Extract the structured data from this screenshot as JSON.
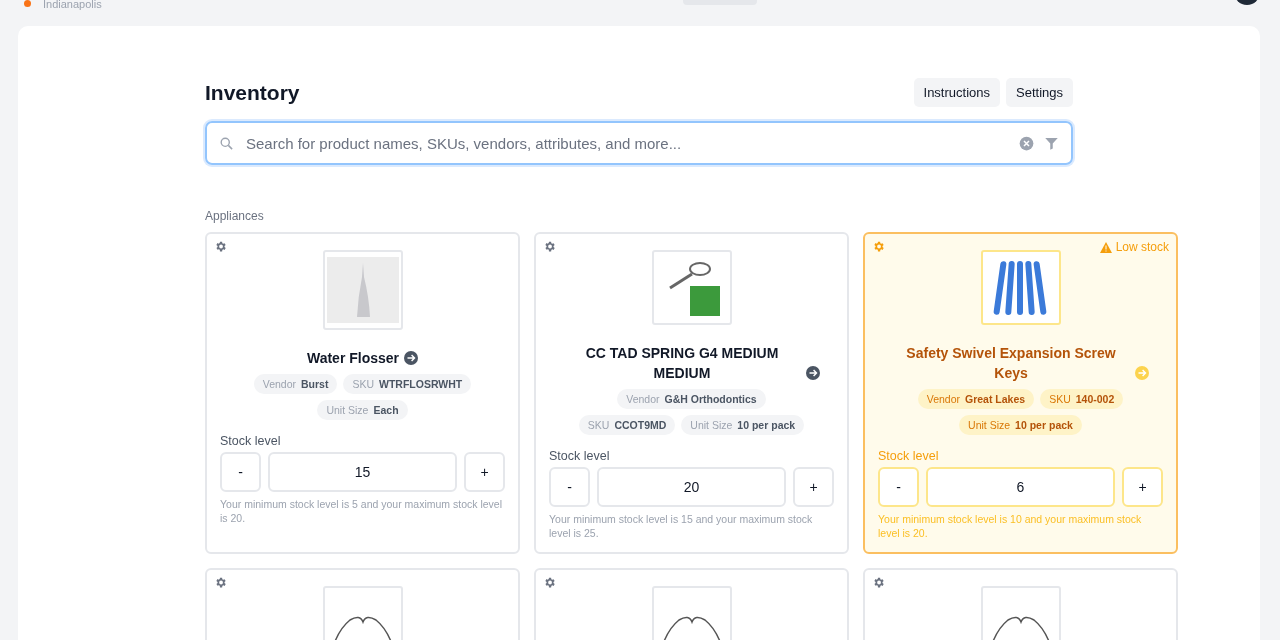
{
  "top_bar": {
    "location": "Indianapolis"
  },
  "header": {
    "title": "Inventory",
    "buttons": [
      "Instructions",
      "Settings"
    ]
  },
  "search": {
    "placeholder": "Search for product names, SKUs, vendors, attributes, and more..."
  },
  "section": {
    "title": "Appliances"
  },
  "products": [
    {
      "kind": "flosser",
      "low_stock": false,
      "name": "Water Flosser",
      "chip_rows": [
        [
          {
            "label": "Vendor",
            "value": "Burst"
          },
          {
            "label": "SKU",
            "value": "WTRFLOSRWHT"
          }
        ],
        [
          {
            "label": "Unit Size",
            "value": "Each"
          }
        ]
      ],
      "stock_label": "Stock level",
      "minus": "-",
      "stock": "15",
      "plus": "+",
      "note": "Your minimum stock level is 5 and your maximum stock level is 20."
    },
    {
      "kind": "spring",
      "low_stock": false,
      "name": "CC TAD SPRING G4 MEDIUM MEDIUM",
      "chip_rows": [
        [
          {
            "label": "Vendor",
            "value": "G&H Orthodontics"
          }
        ],
        [
          {
            "label": "SKU",
            "value": "CCOT9MD"
          },
          {
            "label": "Unit Size",
            "value": "10 per pack"
          }
        ]
      ],
      "stock_label": "Stock level",
      "minus": "-",
      "stock": "20",
      "plus": "+",
      "note": "Your minimum stock level is 15 and your maximum stock level is 25."
    },
    {
      "kind": "keys",
      "low_stock": true,
      "badge": "Low stock",
      "name": "Safety Swivel Expansion Screw Keys",
      "chip_rows": [
        [
          {
            "label": "Vendor",
            "value": "Great Lakes"
          },
          {
            "label": "SKU",
            "value": "140-002"
          }
        ],
        [
          {
            "label": "Unit Size",
            "value": "10 per pack"
          }
        ]
      ],
      "stock_label": "Stock level",
      "minus": "-",
      "stock": "6",
      "plus": "+",
      "note": "Your minimum stock level is 10 and your maximum stock level is 20."
    },
    {
      "kind": "wire",
      "low_stock": false
    },
    {
      "kind": "wire",
      "low_stock": false
    },
    {
      "kind": "wire",
      "low_stock": false
    }
  ]
}
